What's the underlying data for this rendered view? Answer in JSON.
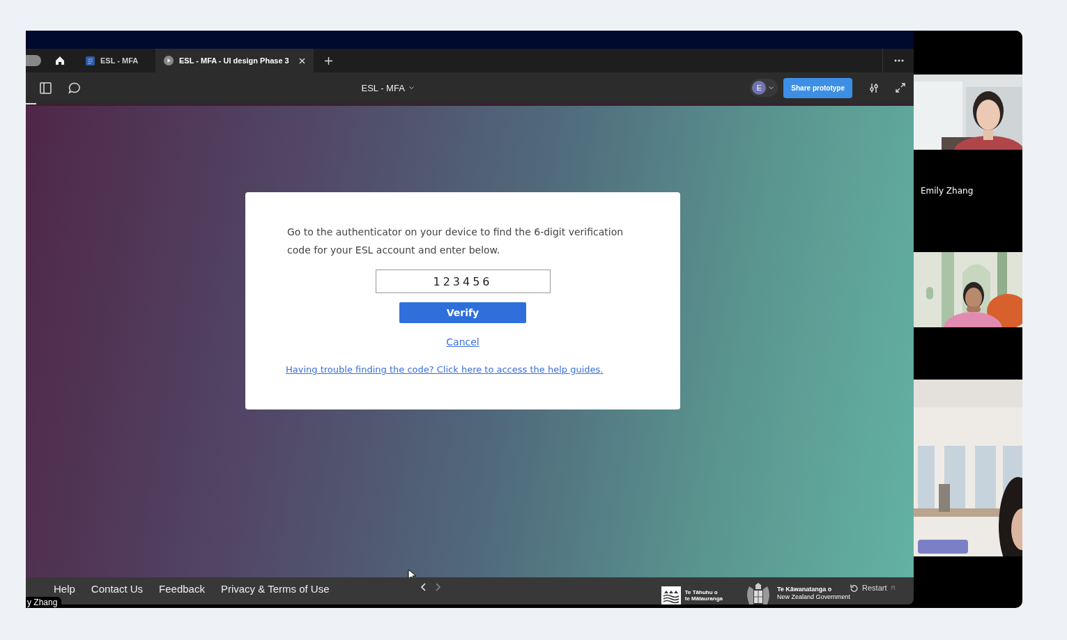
{
  "browser_tabs": [
    {
      "title": "ESL - MFA",
      "selected": false
    },
    {
      "title": "ESL - MFA - UI design Phase 3",
      "selected": true
    }
  ],
  "toolbar": {
    "file_name": "ESL - MFA",
    "avatar_initial": "E",
    "share_button": "Share prototype"
  },
  "dialog": {
    "instructions": "Go to the authenticator on your device to find the 6-digit verification code for your ESL account and enter below.",
    "code_field": {
      "value": "123456"
    },
    "verify_button": "Verify",
    "cancel_link": "Cancel",
    "help_link": "Having trouble finding the code? Click here to access the help guides."
  },
  "footer": {
    "links": [
      "Help",
      "Contact Us",
      "Feedback",
      "Privacy & Terms of Use"
    ],
    "ministry_logo": [
      "Te Tāhuhu o",
      "te Mātauranga"
    ],
    "government_logo": [
      "Te Kāwanatanga o",
      "New Zealand Government"
    ],
    "restart_button": "Restart",
    "restart_shortcut": "R"
  },
  "presenter_label": "y Zhang",
  "participants": [
    {
      "kind": "video"
    },
    {
      "kind": "name",
      "name": "Emily Zhang"
    },
    {
      "kind": "video"
    },
    {
      "kind": "blank"
    },
    {
      "kind": "video"
    }
  ]
}
